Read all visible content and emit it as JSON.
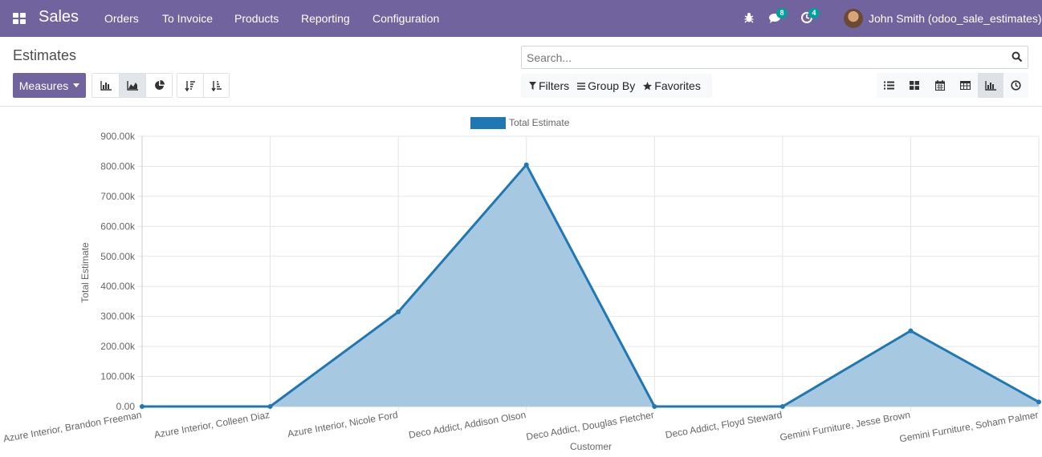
{
  "navbar": {
    "app_name": "Sales",
    "menu": [
      "Orders",
      "To Invoice",
      "Products",
      "Reporting",
      "Configuration"
    ],
    "messages_count": "8",
    "activities_count": "4",
    "user": "John Smith (odoo_sale_estimates)",
    "icons": [
      "apps-icon",
      "bug-icon",
      "chat-icon",
      "clock-icon"
    ]
  },
  "control_panel": {
    "title": "Estimates",
    "search_placeholder": "Search...",
    "measures_label": "Measures",
    "filters_label": "Filters",
    "groupby_label": "Group By",
    "favorites_label": "Favorites",
    "chart_type_buttons": [
      "bar-chart-icon",
      "area-chart-icon",
      "pie-chart-icon"
    ],
    "active_chart_type": "area-chart-icon",
    "sort_buttons": [
      "sort-descending-icon",
      "sort-ascending-icon"
    ],
    "views": [
      "list-icon",
      "kanban-icon",
      "calendar-icon",
      "pivot-icon",
      "graph-icon",
      "activity-icon"
    ],
    "active_view": "graph-icon"
  },
  "chart_data": {
    "type": "area",
    "categories": [
      "Azure Interior, Brandon Freeman",
      "Azure Interior, Colleen Diaz",
      "Azure Interior, Nicole Ford",
      "Deco Addict, Addison Olson",
      "Deco Addict, Douglas Fletcher",
      "Deco Addict, Floyd Steward",
      "Gemini Furniture, Jesse Brown",
      "Gemini Furniture, Soham Palmer"
    ],
    "series": [
      {
        "name": "Total Estimate",
        "values": [
          0,
          0,
          315000,
          805000,
          0,
          0,
          252000,
          15000
        ]
      }
    ],
    "xlabel": "Customer",
    "ylabel": "Total Estimate",
    "ylim": [
      0,
      900000
    ],
    "y_ticks": [
      "0.00",
      "100.00k",
      "200.00k",
      "300.00k",
      "400.00k",
      "500.00k",
      "600.00k",
      "700.00k",
      "800.00k",
      "900.00k"
    ],
    "grid": true,
    "legend": "top-center",
    "colors": {
      "line": "#1f77b4",
      "fill": "#a6c8e0"
    }
  }
}
